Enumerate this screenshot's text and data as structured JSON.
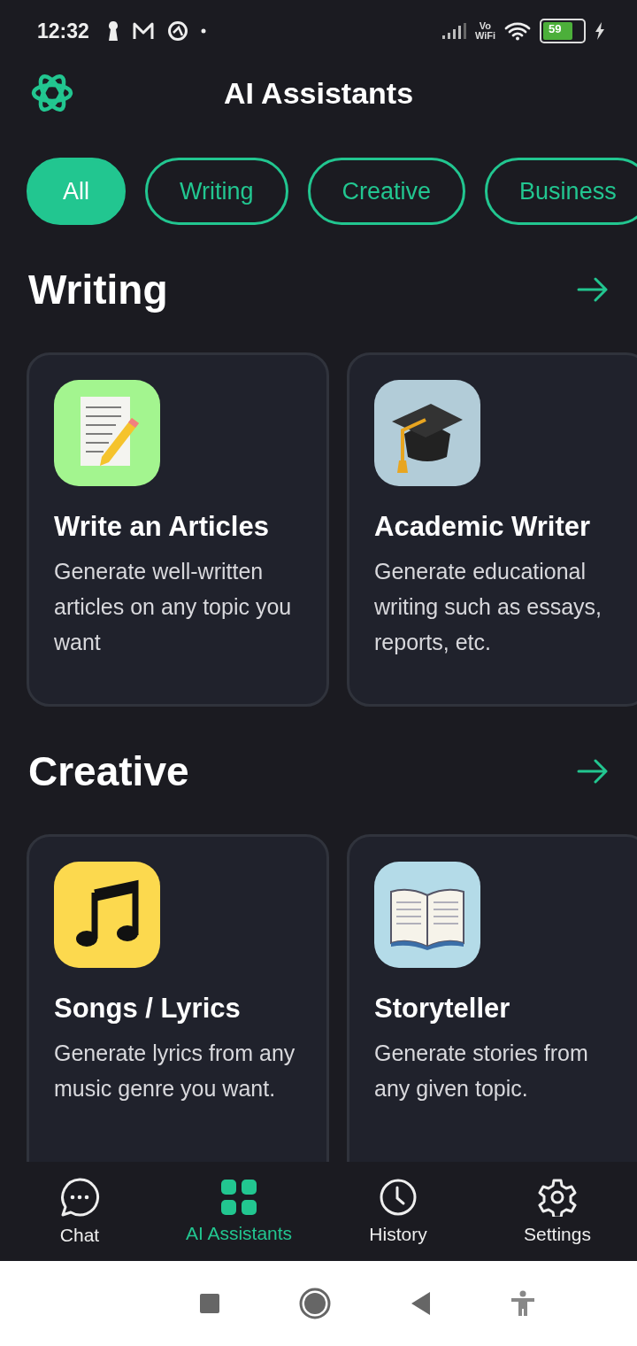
{
  "status_bar": {
    "time": "12:32",
    "vowifi_top": "Vo",
    "vowifi_bottom": "WiFi",
    "battery": "59"
  },
  "header": {
    "title": "AI Assistants"
  },
  "filters": [
    {
      "label": "All",
      "selected": true
    },
    {
      "label": "Writing",
      "selected": false
    },
    {
      "label": "Creative",
      "selected": false
    },
    {
      "label": "Business",
      "selected": false
    }
  ],
  "sections": [
    {
      "title": "Writing",
      "cards": [
        {
          "title": "Write an Articles",
          "description": "Generate well-written articles on any topic you want",
          "kind": "note",
          "color": "#a3f58f"
        },
        {
          "title": "Academic Writer",
          "description": "Generate educational writing such as essays, reports, etc.",
          "kind": "cap",
          "color": "#b2ccd8"
        }
      ]
    },
    {
      "title": "Creative",
      "cards": [
        {
          "title": "Songs / Lyrics",
          "description": "Generate lyrics from any music genre you want.",
          "kind": "music",
          "color": "#fcd94e"
        },
        {
          "title": "Storyteller",
          "description": "Generate stories from any given topic.",
          "kind": "book",
          "color": "#b4dbe8"
        }
      ]
    }
  ],
  "bottom_nav": [
    {
      "label": "Chat",
      "kind": "chat",
      "selected": false
    },
    {
      "label": "AI Assistants",
      "kind": "grid",
      "selected": true
    },
    {
      "label": "History",
      "kind": "clock",
      "selected": false
    },
    {
      "label": "Settings",
      "kind": "gear",
      "selected": false
    }
  ]
}
